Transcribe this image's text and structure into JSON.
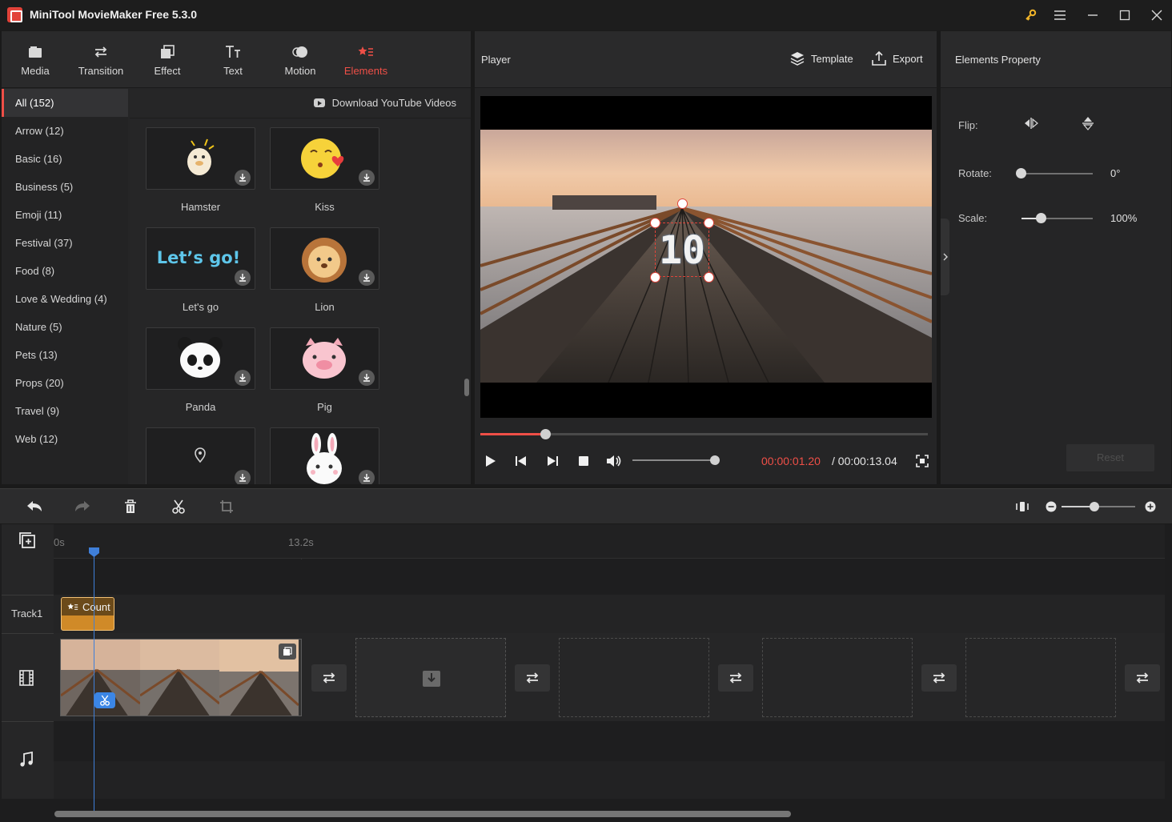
{
  "app": {
    "title": "MiniTool MovieMaker Free 5.3.0"
  },
  "tabs": [
    {
      "label": "Media",
      "icon": "media-icon"
    },
    {
      "label": "Transition",
      "icon": "transition-icon"
    },
    {
      "label": "Effect",
      "icon": "effect-icon"
    },
    {
      "label": "Text",
      "icon": "text-icon"
    },
    {
      "label": "Motion",
      "icon": "motion-icon"
    },
    {
      "label": "Elements",
      "icon": "elements-icon",
      "active": true
    }
  ],
  "categories": [
    "All (152)",
    "Arrow (12)",
    "Basic (16)",
    "Business (5)",
    "Emoji (11)",
    "Festival (37)",
    "Food (8)",
    "Love & Wedding (4)",
    "Nature (5)",
    "Pets (13)",
    "Props (20)",
    "Travel (9)",
    "Web (12)"
  ],
  "library": {
    "download_link": "Download YouTube Videos",
    "elements": [
      {
        "name": "Hamster"
      },
      {
        "name": "Kiss"
      },
      {
        "name": "Let's go",
        "preview_text": "Let’s go!"
      },
      {
        "name": "Lion"
      },
      {
        "name": "Panda"
      },
      {
        "name": "Pig"
      },
      {
        "name": ""
      },
      {
        "name": ""
      }
    ]
  },
  "player": {
    "title": "Player",
    "template_label": "Template",
    "export_label": "Export",
    "overlay_text": "10",
    "current_time": "00:00:01.20",
    "total_time": "/ 00:00:13.04",
    "progress": 0.147,
    "volume": 0.99
  },
  "properties": {
    "title": "Elements Property",
    "flip_label": "Flip:",
    "rotate_label": "Rotate:",
    "rotate_value": "0°",
    "rotate_level": 0.0,
    "scale_label": "Scale:",
    "scale_value": "100%",
    "scale_level": 0.28,
    "reset_label": "Reset"
  },
  "timeline": {
    "zoom_level": 0.45,
    "ruler": [
      "0s",
      "13.2s"
    ],
    "track_label": "Track1",
    "element_clip_label": "Count"
  },
  "colors": {
    "accent": "#ef4f47",
    "playhead": "#3f7fd9",
    "element_clip": "#d08a28"
  }
}
